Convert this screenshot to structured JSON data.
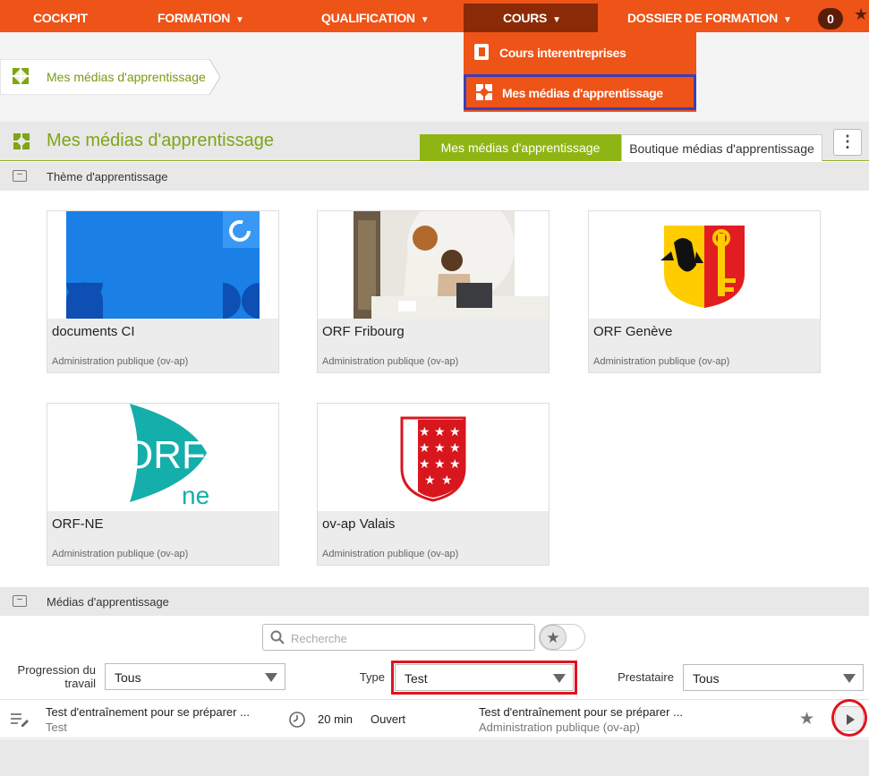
{
  "nav": {
    "items": [
      {
        "label": "COCKPIT",
        "caret": ""
      },
      {
        "label": "FORMATION",
        "caret": "▼"
      },
      {
        "label": "QUALIFICATION",
        "caret": "▼"
      },
      {
        "label": "COURS",
        "caret": "▼"
      },
      {
        "label": "DOSSIER DE FORMATION",
        "caret": "▼"
      }
    ],
    "cart_count": "0",
    "accent": "#ee5317"
  },
  "dropdown": {
    "items": [
      "Cours interentreprises",
      "Mes médias d'apprentissage"
    ]
  },
  "breadcrumb": {
    "label": "Mes médias d'apprentissage"
  },
  "page": {
    "title": "Mes médias d'apprentissage",
    "tabs": [
      "Mes médias d'apprentissage",
      "Boutique médias d'apprentissage"
    ],
    "menu_icon": "⋮"
  },
  "themes_section": {
    "collapse_icon": "−",
    "label": "Thème d'apprentissage",
    "cards": [
      {
        "title": "documents CI",
        "subtitle": "Administration publique (ov-ap)"
      },
      {
        "title": "ORF Fribourg",
        "subtitle": "Administration publique (ov-ap)"
      },
      {
        "title": "ORF Genève",
        "subtitle": "Administration publique (ov-ap)"
      },
      {
        "title": "ORF-NE",
        "subtitle": "Administration publique (ov-ap)"
      },
      {
        "title": "ov-ap Valais",
        "subtitle": "Administration publique (ov-ap)"
      }
    ]
  },
  "logo_text": {
    "orf": "ORF",
    "ne": "ne"
  },
  "media_section": {
    "collapse_icon": "−",
    "label": "Médias d'apprentissage",
    "search": {
      "placeholder": "Recherche"
    },
    "filters": {
      "progress": {
        "label": "Progression du travail",
        "value": "Tous"
      },
      "type": {
        "label": "Type",
        "value": "Test"
      },
      "provider": {
        "label": "Prestataire",
        "value": "Tous"
      }
    },
    "rows": [
      {
        "title": "Test d'entraînement pour se préparer ...",
        "kind": "Test",
        "duration": "20 min",
        "status": "Ouvert",
        "course": "Test d'entraînement pour se préparer ...",
        "provider": "Administration publique (ov-ap)"
      }
    ]
  },
  "colors": {
    "brand_green": "#8fb515",
    "highlight_red": "#e1121f",
    "highlight_blue": "#3a3fb8"
  }
}
